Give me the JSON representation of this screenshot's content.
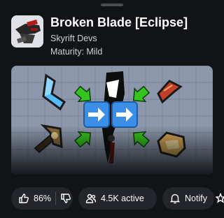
{
  "header": {
    "title": "Broken Blade [Eclipse]",
    "creator": "Skyrift Devs",
    "maturity": "Maturity: Mild"
  },
  "icons": {
    "drag_handle": "drag-handle",
    "game_icon": "game-icon",
    "like": "thumbs-up-icon",
    "dislike": "thumbs-down-icon",
    "players": "users-icon",
    "notify": "bell-icon",
    "more": "star-icon"
  },
  "actions": {
    "like_percent": "86%",
    "active": "4.5K active",
    "notify_label": "Notify"
  },
  "colors": {
    "background": "#121317",
    "pill": "#23252b",
    "arrow_green": "#35c51f",
    "arrow_box": "#3b8fe6"
  }
}
